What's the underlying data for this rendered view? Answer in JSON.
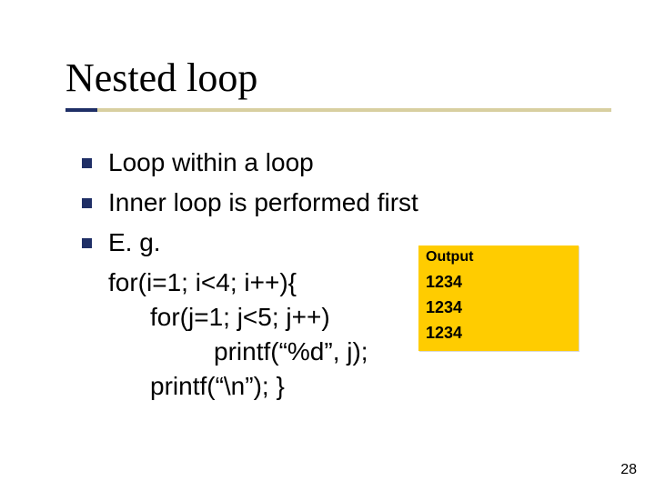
{
  "title": "Nested loop",
  "bullets": [
    "Loop within a loop",
    "Inner loop is performed first",
    "E. g."
  ],
  "code": {
    "line1": "for(i=1; i<4; i++){",
    "line2": "for(j=1; j<5; j++)",
    "line3": "printf(“%d”, j);",
    "line4": "printf(“\\n”); }"
  },
  "output": {
    "label": "Output",
    "rows": [
      "1234",
      "1234",
      "1234"
    ]
  },
  "page_number": "28"
}
